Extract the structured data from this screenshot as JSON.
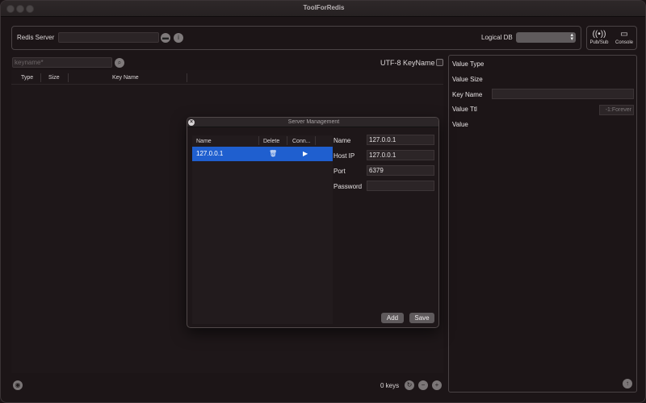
{
  "window": {
    "title": "ToolForRedis"
  },
  "toolbar": {
    "redis_server_label": "Redis Server",
    "redis_server_value": "",
    "logical_db_label": "Logical DB",
    "logical_db_value": "",
    "pubsub_label": "Pub/Sub",
    "console_label": "Console"
  },
  "search": {
    "placeholder": "keyname*",
    "utf8_label": "UTF-8 KeyName",
    "utf8_checked": false
  },
  "key_table": {
    "columns": [
      "Type",
      "Size",
      "Key Name"
    ],
    "rows": []
  },
  "status": {
    "keys_count": "0 keys"
  },
  "value_panel": {
    "value_type_label": "Value Type",
    "value_size_label": "Value Size",
    "key_name_label": "Key Name",
    "value_ttl_label": "Value Ttl",
    "ttl_placeholder": "-1:Forever",
    "value_label": "Value"
  },
  "dialog": {
    "title": "Server Management",
    "columns": [
      "Name",
      "Delete",
      "Conn..."
    ],
    "rows": [
      {
        "name": "127.0.0.1"
      }
    ],
    "fields": {
      "name_label": "Name",
      "name_value": "127.0.0.1",
      "host_label": "Host IP",
      "host_value": "127.0.0.1",
      "port_label": "Port",
      "port_value": "6379",
      "password_label": "Password",
      "password_value": ""
    },
    "add_label": "Add",
    "save_label": "Save"
  },
  "colors": {
    "selection": "#1f5fcf",
    "background": "#1c1517"
  }
}
